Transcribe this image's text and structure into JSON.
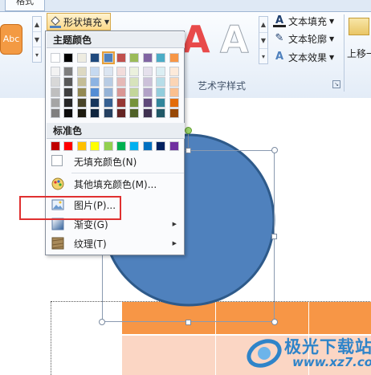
{
  "ribbon": {
    "active_tab": "格式",
    "style_sample": "Abc",
    "shape_fill_label": "形状填充",
    "wordart_samples": [
      "A",
      "A"
    ],
    "text_commands": [
      {
        "label": "文本填充",
        "icon": "text-fill-icon"
      },
      {
        "label": "文本轮廓",
        "icon": "text-outline-icon"
      },
      {
        "label": "文本效果",
        "icon": "text-effects-icon"
      }
    ],
    "group_label": "艺术字样式",
    "move_up_label": "上移一"
  },
  "menu": {
    "theme_colors_header": "主题颜色",
    "theme_colors_top": [
      "#ffffff",
      "#000000",
      "#eeece1",
      "#1f497d",
      "#4f81bd",
      "#c0504d",
      "#9bbb59",
      "#8064a2",
      "#4bacc6",
      "#f79646"
    ],
    "theme_shades": [
      [
        "#f2f2f2",
        "#7f7f7f",
        "#ddd9c3",
        "#c6d9f0",
        "#dbe5f1",
        "#f2dcdb",
        "#ebf1dd",
        "#e5e0ec",
        "#dbeef3",
        "#fdeada"
      ],
      [
        "#d8d8d8",
        "#595959",
        "#c4bd97",
        "#8db3e2",
        "#b8cce4",
        "#e5b9b7",
        "#d7e3bc",
        "#ccc1d9",
        "#b7dde8",
        "#fbd5b5"
      ],
      [
        "#bfbfbf",
        "#3f3f3f",
        "#938953",
        "#548dd4",
        "#95b3d7",
        "#d99694",
        "#c3d69b",
        "#b2a2c7",
        "#92cddc",
        "#fac08f"
      ],
      [
        "#a5a5a5",
        "#262626",
        "#494429",
        "#17365d",
        "#366092",
        "#953734",
        "#76923c",
        "#5f497a",
        "#31859b",
        "#e36c09"
      ],
      [
        "#7f7f7f",
        "#0c0c0c",
        "#1d1b10",
        "#0f243e",
        "#244061",
        "#632423",
        "#4f6128",
        "#3f3151",
        "#205867",
        "#974806"
      ]
    ],
    "standard_colors_header": "标准色",
    "standard_colors": [
      "#c00000",
      "#ff0000",
      "#ffc000",
      "#ffff00",
      "#92d050",
      "#00b050",
      "#00b0f0",
      "#0070c0",
      "#002060",
      "#7030a0"
    ],
    "selected_color": "#4f81bd",
    "items": [
      {
        "label": "无填充颜色(N)",
        "icon": "no-fill-icon"
      },
      {
        "label": "其他填充颜色(M)...",
        "icon": "palette-icon"
      },
      {
        "label": "图片(P)...",
        "icon": "picture-icon"
      },
      {
        "label": "渐变(G)",
        "icon": "gradient-icon",
        "submenu": true
      },
      {
        "label": "纹理(T)",
        "icon": "texture-icon",
        "submenu": true
      }
    ]
  },
  "canvas": {
    "circle_color": "#4f81bd",
    "table_header_color": "#f79646",
    "table_body_color": "#fbd6c4"
  },
  "watermark": {
    "title": "极光下载站",
    "url": "www.xz7.com"
  }
}
